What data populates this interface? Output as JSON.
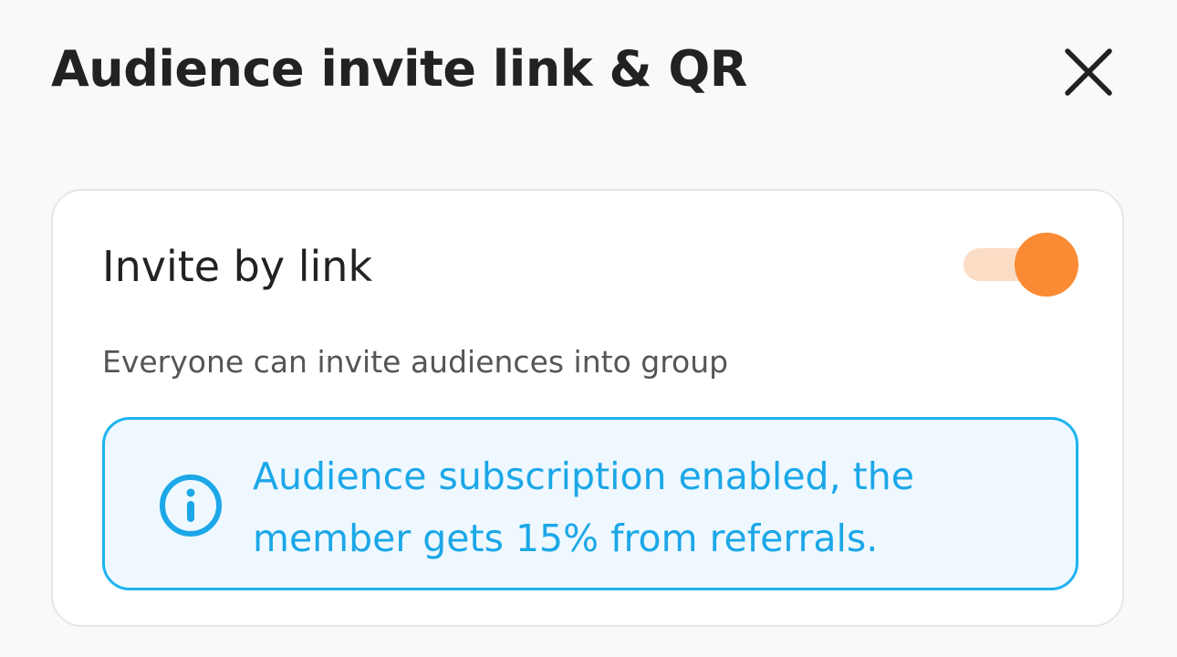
{
  "header": {
    "title": "Audience invite link & QR",
    "close_icon": "close-icon"
  },
  "invite_card": {
    "title": "Invite by link",
    "toggle_on": true,
    "description": "Everyone can invite audiences into group",
    "info": {
      "icon": "info-icon",
      "text": "Audience subscription enabled, the member gets 15% from referrals."
    }
  },
  "colors": {
    "accent": "#fa8a34",
    "accent_light": "#fbdcc4",
    "info_blue": "#1ba7e8",
    "info_bg": "#eef8fe"
  }
}
